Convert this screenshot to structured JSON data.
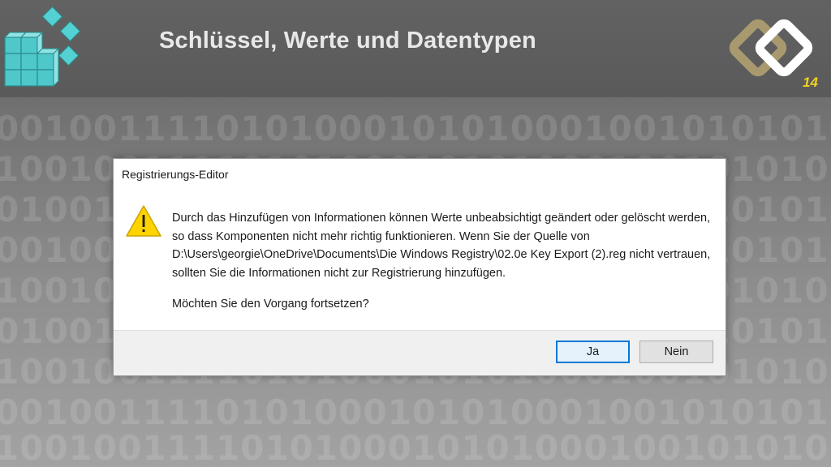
{
  "slide": {
    "title": "Schlüssel, Werte und Datentypen",
    "number": "14",
    "number_color": "#f2d21b"
  },
  "background": {
    "binary_lines": [
      "00100111101010001010100010010101010",
      "10010011110101000101010001001010101",
      "01001001111010100010101000100101010",
      "00100111101010001010100010010101010",
      "10010011110101000101010001001010101",
      "01001001111010100010101000100101010",
      "10010011110101000101010001001010101",
      "00100111101010001010100010010101010",
      "10010011110101000101010001001010101"
    ]
  },
  "icons": {
    "app_logo": "registry-editor-cubes-icon",
    "brand_logo": "brand-chain-logo",
    "warning": "warning-triangle-icon"
  },
  "dialog": {
    "title": "Registrierungs-Editor",
    "message": "Durch das Hinzufügen von Informationen können Werte unbeabsichtigt geändert oder gelöscht werden, so dass Komponenten nicht mehr richtig funktionieren. Wenn Sie der Quelle von D:\\Users\\georgie\\OneDrive\\Documents\\Die Windows Registry\\02.0e Key Export (2).reg nicht vertrauen, sollten Sie die Informationen nicht zur Registrierung hinzufügen.",
    "question": "Möchten Sie den Vorgang fortsetzen?",
    "buttons": {
      "yes": "Ja",
      "no": "Nein"
    },
    "accent_color": "#0078d7",
    "warning_color": "#ffd300"
  }
}
